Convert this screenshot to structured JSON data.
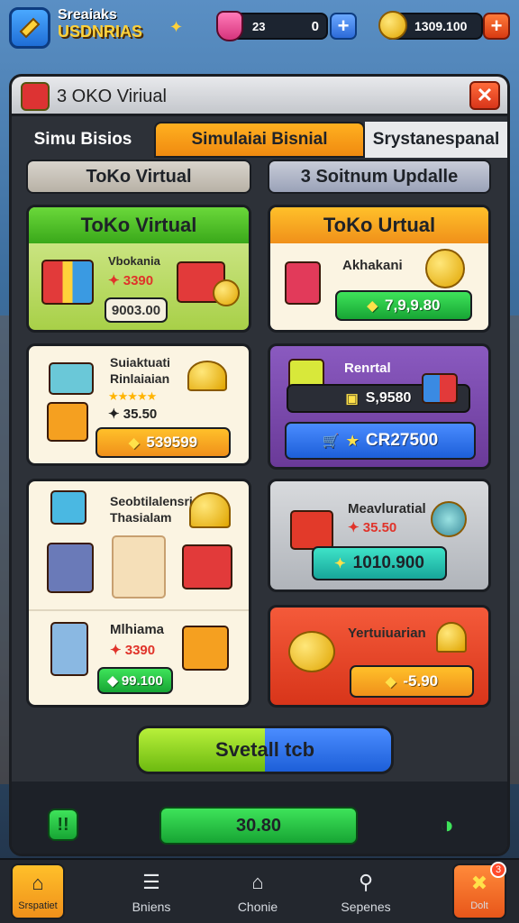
{
  "hud": {
    "brand_line1": "Sreaiaks",
    "brand_line2": "USDNRIAS",
    "res1_small": "23",
    "res1_value": "0",
    "res2_value": "1309.100",
    "plus_symbol": "+"
  },
  "panel": {
    "title": "3 OKO Viriual",
    "close_symbol": "✕",
    "tabs": [
      "Simu Bisios",
      "Simulaiai Bisnial",
      "Srystanespanal"
    ],
    "subtabs": [
      "ToKo Virtual",
      "3 Soitnum Updalle"
    ]
  },
  "cards": {
    "c1": {
      "title": "ToKo Virtual",
      "label": "Vbokania",
      "price": "✦ 3390",
      "btn": "9003.00"
    },
    "c2": {
      "title": "ToKo Urtual",
      "label": "Akhakani",
      "btn": "7,9,9.80"
    },
    "c3": {
      "label1": "Suiaktuati",
      "label2": "Rinlaiaian",
      "price": "✦ 35.50",
      "btn": "539599"
    },
    "c4": {
      "label": "Renrtal",
      "price": "S,9580",
      "btn": "CR27500"
    },
    "c5": {
      "label1": "Seobtilalensria",
      "label2": "Thasialam",
      "sub_label": "Mlhiama",
      "price": "✦ 3390",
      "btn": "99.100"
    },
    "c6": {
      "label": "Meavluratial",
      "price": "✦ 35.50",
      "btn": "1010.900"
    },
    "c7": {
      "label": "Yertuiuarian",
      "btn": "-5.90"
    }
  },
  "big_button": "Svetall tcb",
  "footer": {
    "value": "30.80"
  },
  "nav": {
    "items": [
      {
        "label": "Srspatiet",
        "icon": "home-icon"
      },
      {
        "label": "Bniens",
        "icon": "list-icon"
      },
      {
        "label": "Chonie",
        "icon": "house-icon"
      },
      {
        "label": "Sepenes",
        "icon": "search-icon"
      },
      {
        "label": "Dolt",
        "icon": "star-badge-icon"
      }
    ],
    "badge": "3"
  },
  "colors": {
    "green": "#5cc62a",
    "orange": "#f7a21b",
    "purple": "#7a4aa8",
    "grey": "#bfc2c7",
    "red": "#e4412a",
    "cream": "#fbf4e2"
  }
}
